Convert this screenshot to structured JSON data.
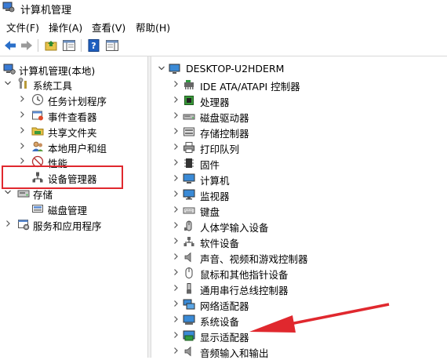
{
  "window": {
    "title": "计算机管理"
  },
  "menu": [
    {
      "id": "file",
      "label": "文件(F)"
    },
    {
      "id": "action",
      "label": "操作(A)"
    },
    {
      "id": "view",
      "label": "查看(V)"
    },
    {
      "id": "help",
      "label": "帮助(H)"
    }
  ],
  "left_tree": {
    "root": "计算机管理(本地)",
    "system_tools": "系统工具",
    "task_scheduler": "任务计划程序",
    "event_viewer": "事件查看器",
    "shared_folders": "共享文件夹",
    "local_users": "本地用户和组",
    "performance": "性能",
    "device_manager": "设备管理器",
    "storage": "存储",
    "disk_management": "磁盘管理",
    "services": "服务和应用程序"
  },
  "right_tree": {
    "root": "DESKTOP-U2HDERM",
    "items": [
      "IDE ATA/ATAPI 控制器",
      "处理器",
      "磁盘驱动器",
      "存储控制器",
      "打印队列",
      "固件",
      "计算机",
      "监视器",
      "键盘",
      "人体学输入设备",
      "软件设备",
      "声音、视频和游戏控制器",
      "鼠标和其他指针设备",
      "通用串行总线控制器",
      "网络适配器",
      "系统设备",
      "显示适配器",
      "音频输入和输出"
    ]
  },
  "colors": {
    "annotation": "#e0282e",
    "icon_blue": "#1e73be"
  }
}
